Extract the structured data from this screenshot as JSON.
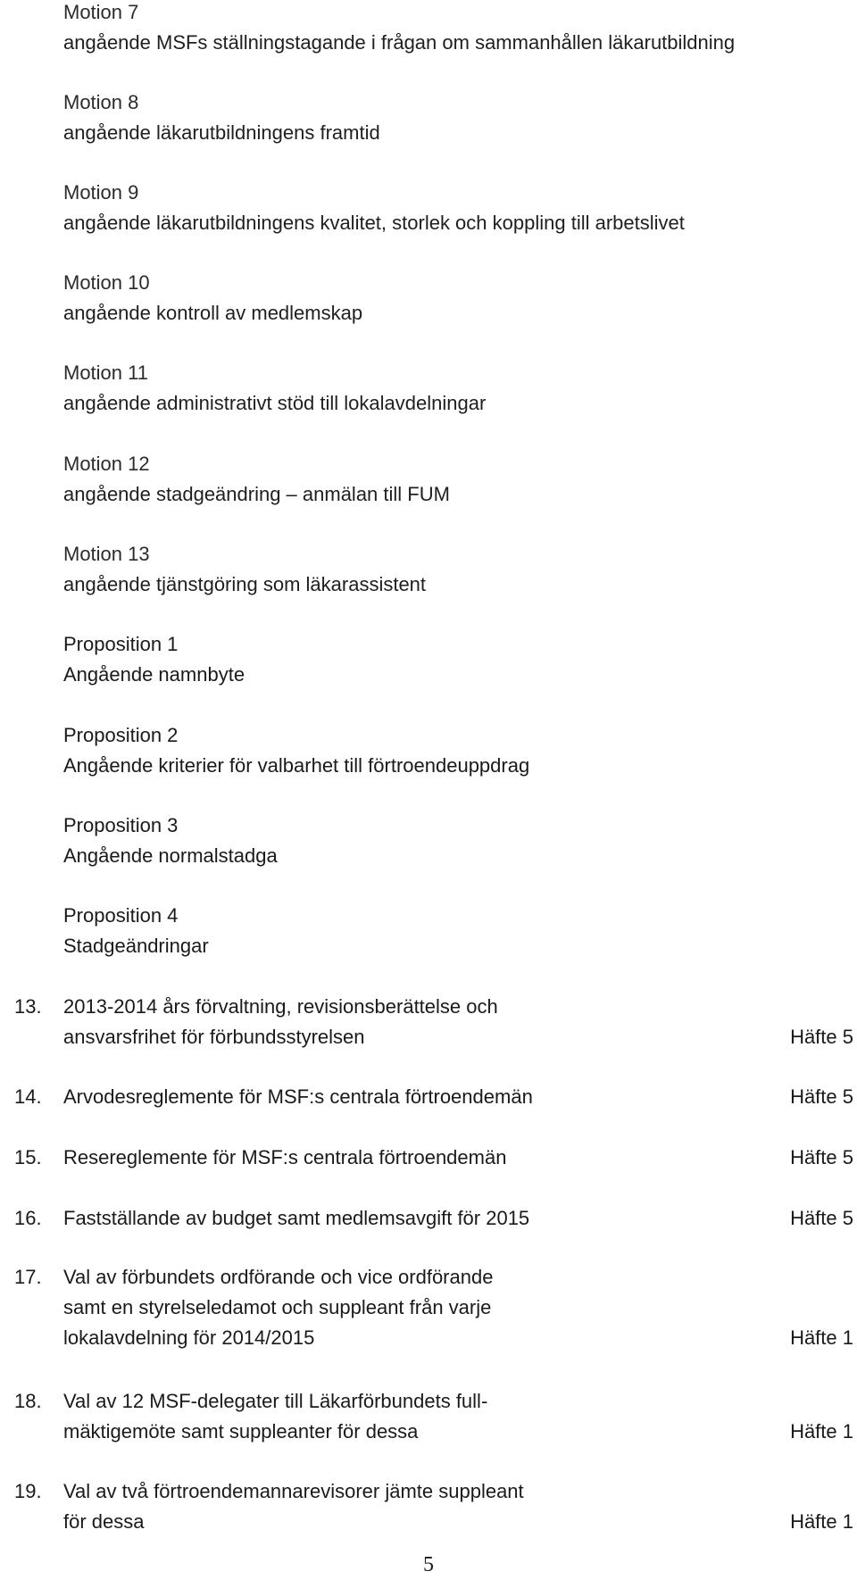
{
  "motions": [
    {
      "title": "Motion 7",
      "subject": "angående MSFs ställningstagande i frågan om sammanhållen läkarutbildning"
    },
    {
      "title": "Motion 8",
      "subject": "angående läkarutbildningens framtid"
    },
    {
      "title": "Motion 9",
      "subject": "angående läkarutbildningens kvalitet, storlek och koppling till arbetslivet"
    },
    {
      "title": "Motion 10",
      "subject": "angående kontroll av medlemskap"
    },
    {
      "title": "Motion 11",
      "subject": "angående administrativt stöd till lokalavdelningar"
    },
    {
      "title": "Motion 12",
      "subject": "angående stadgeändring – anmälan till FUM"
    },
    {
      "title": "Motion 13",
      "subject": "angående tjänstgöring som läkarassistent"
    }
  ],
  "propositions": [
    {
      "title": "Proposition 1",
      "subject": "Angående namnbyte"
    },
    {
      "title": "Proposition 2",
      "subject": "Angående kriterier för valbarhet till förtroendeuppdrag"
    },
    {
      "title": "Proposition 3",
      "subject": "Angående normalstadga"
    },
    {
      "title": "Proposition 4",
      "subject": "Stadgeändringar"
    }
  ],
  "agenda_items": [
    {
      "number": "13.",
      "lines": [
        "2013-2014 års förvaltning, revisionsberättelse och",
        "ansvarsfrihet för förbundsstyrelsen"
      ],
      "reference": "Häfte 5"
    },
    {
      "number": "14.",
      "lines": [
        "Arvodesreglemente för MSF:s centrala förtroendemän"
      ],
      "reference": "Häfte 5"
    },
    {
      "number": "15.",
      "lines": [
        "Resereglemente för MSF:s centrala förtroendemän"
      ],
      "reference": "Häfte 5"
    },
    {
      "number": "16.",
      "lines": [
        "Fastställande av budget samt medlemsavgift för 2015"
      ],
      "reference": "Häfte 5"
    },
    {
      "number": "17.",
      "lines": [
        "Val av förbundets ordförande och vice ordförande",
        "samt en styrelseledamot och suppleant från varje",
        "lokalavdelning för 2014/2015"
      ],
      "reference": "Häfte 1"
    },
    {
      "number": "18.",
      "lines": [
        "Val av 12 MSF-delegater till Läkarförbundets full-",
        "mäktigemöte samt suppleanter för dessa"
      ],
      "reference": "Häfte 1"
    },
    {
      "number": "19.",
      "lines": [
        "Val av två förtroendemannarevisorer jämte suppleant",
        "för dessa"
      ],
      "reference": "Häfte 1"
    }
  ],
  "page_number": "5"
}
